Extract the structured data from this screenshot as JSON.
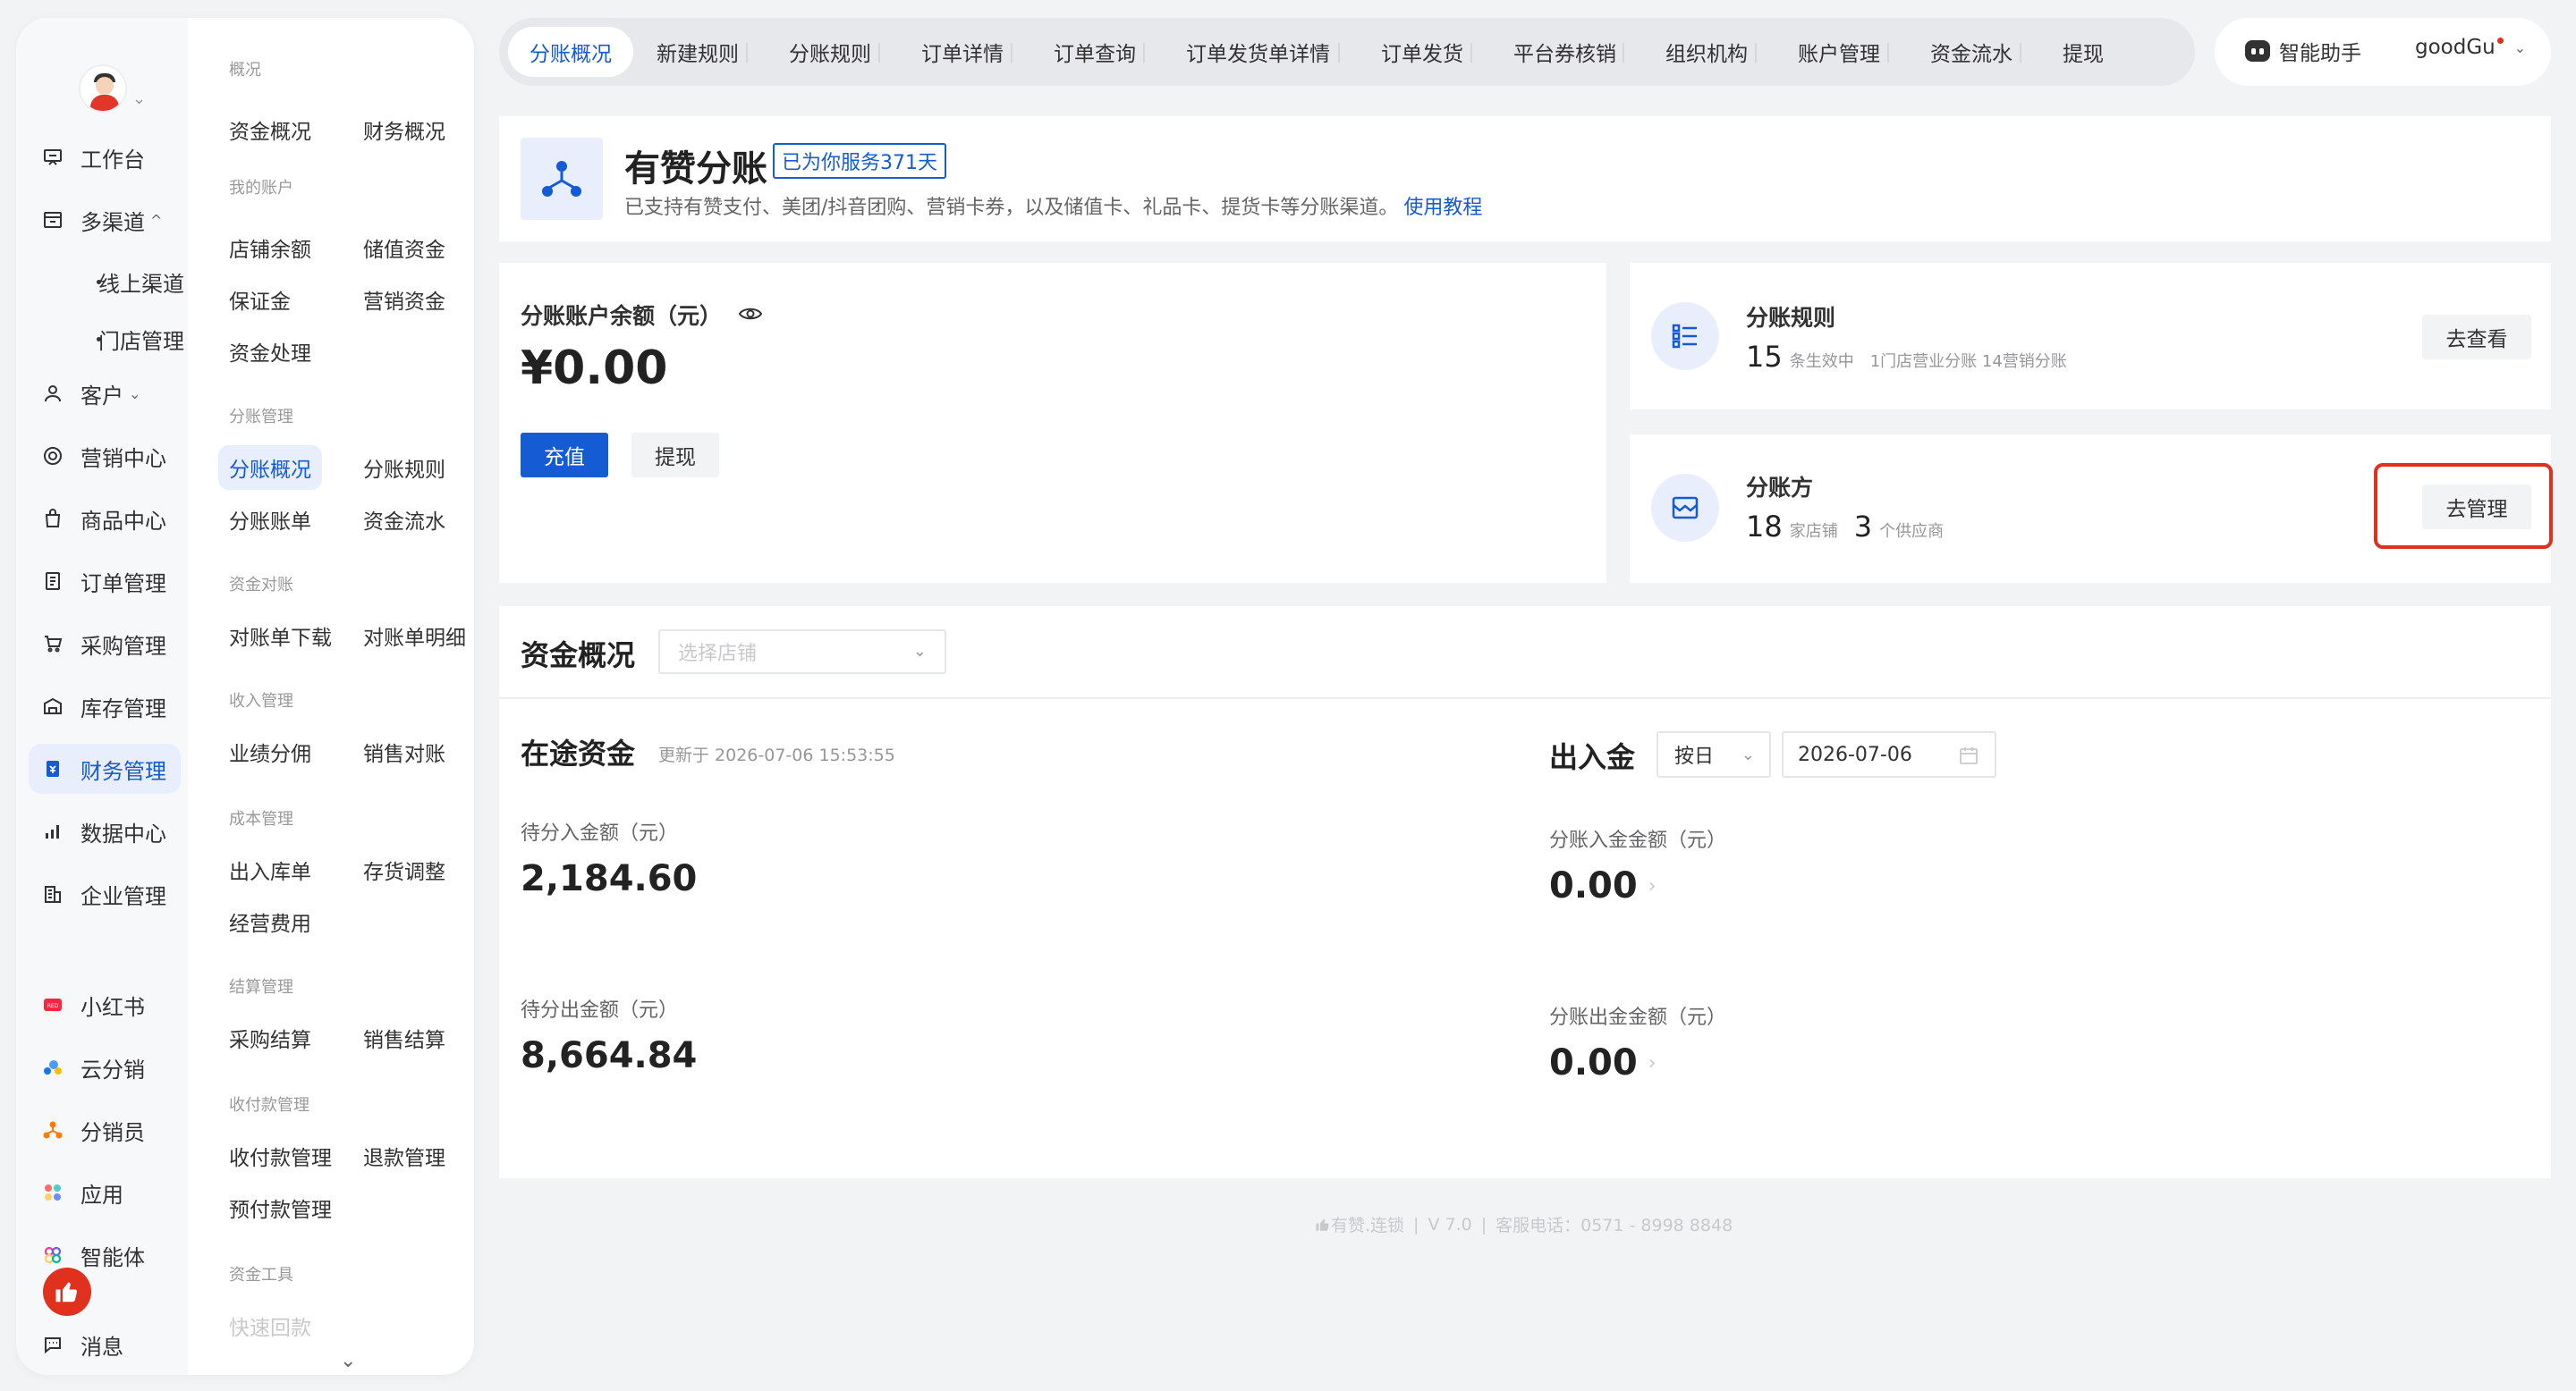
{
  "primary_nav": {
    "items": [
      {
        "label": "工作台",
        "icon": "desk-icon"
      },
      {
        "label": "多渠道",
        "icon": "store-icon",
        "expanded": true
      },
      {
        "label": "客户",
        "icon": "user-icon"
      },
      {
        "label": "营销中心",
        "icon": "target-icon"
      },
      {
        "label": "商品中心",
        "icon": "bag-icon"
      },
      {
        "label": "订单管理",
        "icon": "order-icon"
      },
      {
        "label": "采购管理",
        "icon": "cart-icon"
      },
      {
        "label": "库存管理",
        "icon": "warehouse-icon"
      },
      {
        "label": "财务管理",
        "icon": "finance-icon",
        "active": true
      },
      {
        "label": "数据中心",
        "icon": "chart-icon"
      },
      {
        "label": "企业管理",
        "icon": "building-icon"
      },
      {
        "label": "小红书",
        "icon": "xiaohongshu-icon"
      },
      {
        "label": "云分销",
        "icon": "cloud-icon"
      },
      {
        "label": "分销员",
        "icon": "distributor-icon"
      },
      {
        "label": "应用",
        "icon": "apps-icon"
      },
      {
        "label": "智能体",
        "icon": "agent-icon"
      },
      {
        "label": "消息",
        "icon": "message-icon"
      }
    ],
    "sub_items": [
      "线上渠道",
      "门店管理"
    ]
  },
  "secondary_nav": {
    "groups": {
      "overview": "概况",
      "accounts": "我的账户",
      "split": "分账管理",
      "reconcile": "资金对账",
      "income": "收入管理",
      "cost": "成本管理",
      "settle": "结算管理",
      "payment": "收付款管理",
      "tools": "资金工具"
    },
    "items": {
      "fund_overview": "资金概况",
      "finance_overview": "财务概况",
      "store_balance": "店铺余额",
      "stored_value": "储值资金",
      "deposit": "保证金",
      "marketing_funds": "营销资金",
      "fund_processing": "资金处理",
      "split_overview": "分账概况",
      "split_rules": "分账规则",
      "split_bills": "分账账单",
      "fund_flow": "资金流水",
      "statement_download": "对账单下载",
      "statement_detail": "对账单明细",
      "performance_share": "业绩分佣",
      "sales_reconcile": "销售对账",
      "stock_in_out": "出入库单",
      "stock_adjust": "存货调整",
      "operating_expense": "经营费用",
      "purchase_settle": "采购结算",
      "sales_settle": "销售结算",
      "payment_mgmt": "收付款管理",
      "refund_mgmt": "退款管理",
      "prepay_mgmt": "预付款管理",
      "quick_collect": "快速回款"
    }
  },
  "tabs": [
    "分账概况",
    "新建规则",
    "分账规则",
    "订单详情",
    "订单查询",
    "订单发货单详情",
    "订单发货",
    "平台券核销",
    "组织机构",
    "账户管理",
    "资金流水",
    "提现"
  ],
  "assistant": {
    "label": "智能助手",
    "user": "goodGu"
  },
  "header": {
    "title": "有赞分账",
    "badge": "已为你服务371天",
    "desc": "已支持有赞支付、美团/抖音团购、营销卡券，以及储值卡、礼品卡、提货卡等分账渠道。",
    "link": "使用教程"
  },
  "balance": {
    "label": "分账账户余额（元）",
    "amount": "¥0.00",
    "recharge": "充值",
    "withdraw": "提现"
  },
  "rules_card": {
    "title": "分账规则",
    "count": "15",
    "unit": "条生效中",
    "detail": "1门店营业分账 14营销分账",
    "button": "去查看"
  },
  "parties_card": {
    "title": "分账方",
    "stores": "18",
    "stores_unit": "家店铺",
    "suppliers": "3",
    "suppliers_unit": "个供应商",
    "button": "去管理"
  },
  "funds": {
    "title": "资金概况",
    "store_placeholder": "选择店铺",
    "in_transit": {
      "title": "在途资金",
      "updated": "更新于 2026-07-06 15:53:55",
      "pending_in_label": "待分入金额（元）",
      "pending_in_value": "2,184.60",
      "pending_out_label": "待分出金额（元）",
      "pending_out_value": "8,664.84"
    },
    "flow": {
      "title": "出入金",
      "period": "按日",
      "date": "2026-07-06",
      "in_label": "分账入金金额（元）",
      "in_value": "0.00",
      "out_label": "分账出金金额（元）",
      "out_value": "0.00"
    }
  },
  "footer": {
    "brand": "有赞.连锁",
    "version": "V 7.0",
    "phone": "客服电话：0571 - 8998 8848"
  },
  "colors": {
    "accent": "#155bd4",
    "highlight": "#e0301e"
  }
}
